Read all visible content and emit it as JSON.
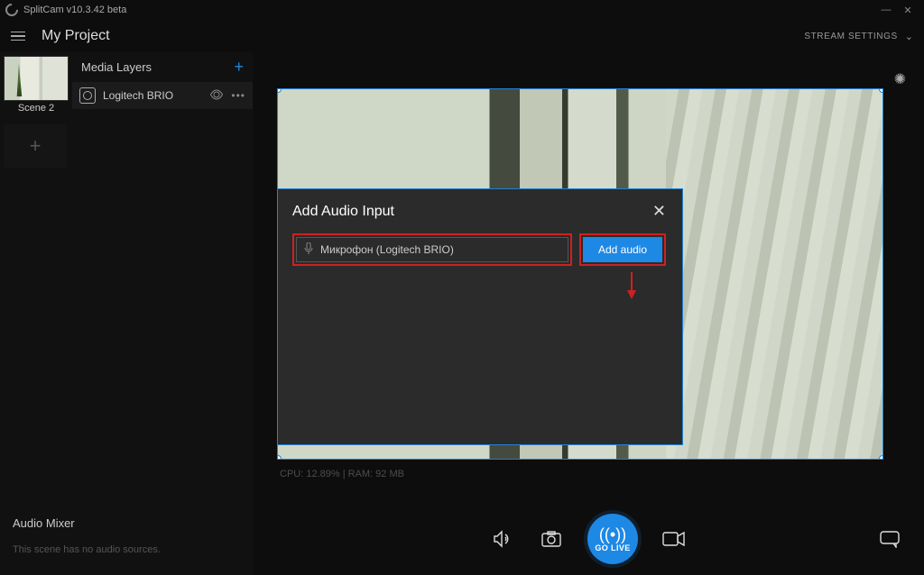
{
  "window": {
    "title": "SplitCam v10.3.42 beta"
  },
  "header": {
    "project_title": "My Project",
    "stream_settings_label": "STREAM SETTINGS"
  },
  "sidebar": {
    "scene_thumb_label": "Scene 2",
    "layers_header": "Media Layers",
    "layer_item": {
      "name": "Logitech BRIO"
    },
    "audio_mixer_header": "Audio Mixer",
    "audio_mixer_empty": "This scene has no audio sources."
  },
  "preview": {
    "stats": "CPU: 12.89% | RAM: 92 MB"
  },
  "modal": {
    "title": "Add Audio Input",
    "device_name": "Микрофон (Logitech BRIO)",
    "add_button": "Add audio"
  },
  "toolbar": {
    "go_live_label": "GO LIVE"
  }
}
